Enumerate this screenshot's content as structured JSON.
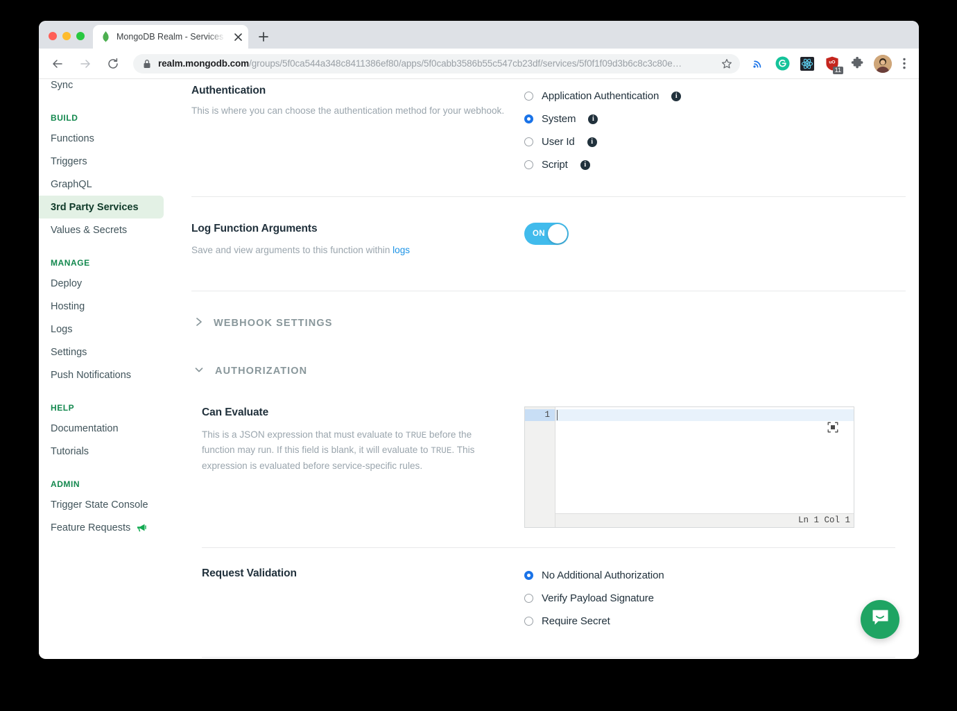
{
  "browser": {
    "tab": {
      "title": "MongoDB Realm - Services - k",
      "favicon": "mongodb-leaf-icon",
      "close_icon": "close-icon",
      "new_tab_icon": "plus-icon"
    },
    "toolbar": {
      "back_icon": "back-arrow-icon",
      "forward_icon": "forward-arrow-icon",
      "reload_icon": "reload-icon",
      "lock_icon": "lock-icon",
      "url_host": "realm.mongodb.com",
      "url_path": "/groups/5f0ca544a348c8411386ef80/apps/5f0cabb3586b55c547cb23df/services/5f0f1f09d3b6c8c3c80e…",
      "star_icon": "star-icon",
      "extensions": [
        {
          "name": "cast-icon",
          "label": ""
        },
        {
          "name": "grammarly-icon",
          "label": "G"
        },
        {
          "name": "react-devtools-icon",
          "label": ""
        },
        {
          "name": "ublock-origin-icon",
          "label": "uO",
          "badge": "11"
        },
        {
          "name": "puzzle-extensions-icon",
          "label": ""
        }
      ],
      "avatar": "user-avatar",
      "menu_icon": "three-dot-menu-icon"
    }
  },
  "sidebar": {
    "items": [
      {
        "label": "Sync",
        "type": "link",
        "selected": false
      },
      {
        "label": "BUILD",
        "type": "section"
      },
      {
        "label": "Functions",
        "type": "link",
        "selected": false
      },
      {
        "label": "Triggers",
        "type": "link",
        "selected": false
      },
      {
        "label": "GraphQL",
        "type": "link",
        "selected": false
      },
      {
        "label": "3rd Party Services",
        "type": "link",
        "selected": true
      },
      {
        "label": "Values & Secrets",
        "type": "link",
        "selected": false
      },
      {
        "label": "MANAGE",
        "type": "section"
      },
      {
        "label": "Deploy",
        "type": "link",
        "selected": false
      },
      {
        "label": "Hosting",
        "type": "link",
        "selected": false
      },
      {
        "label": "Logs",
        "type": "link",
        "selected": false
      },
      {
        "label": "Settings",
        "type": "link",
        "selected": false
      },
      {
        "label": "Push Notifications",
        "type": "link",
        "selected": false
      },
      {
        "label": "HELP",
        "type": "section"
      },
      {
        "label": "Documentation",
        "type": "link",
        "selected": false
      },
      {
        "label": "Tutorials",
        "type": "link",
        "selected": false
      },
      {
        "label": "ADMIN",
        "type": "section"
      },
      {
        "label": "Trigger State Console",
        "type": "link",
        "selected": false
      },
      {
        "label": "Feature Requests",
        "type": "link",
        "selected": false,
        "icon": "megaphone-icon"
      }
    ],
    "selected_bg": "#e3f1e5",
    "section_color": "#13884e"
  },
  "main": {
    "authentication": {
      "title": "Authentication",
      "description": "This is where you can choose the authentication method for your webhook.",
      "options": [
        {
          "label": "Application Authentication",
          "checked": false,
          "info": true
        },
        {
          "label": "System",
          "checked": true,
          "info": true
        },
        {
          "label": "User Id",
          "checked": false,
          "info": true
        },
        {
          "label": "Script",
          "checked": false,
          "info": true
        }
      ]
    },
    "log_function_arguments": {
      "title": "Log Function Arguments",
      "description_pre": "Save and view arguments to this function within ",
      "description_link": "logs",
      "toggle_state": "ON",
      "toggle_on": true,
      "toggle_color": "#41bbec"
    },
    "webhook_settings": {
      "caption": "WEBHOOK SETTINGS",
      "expanded": false,
      "chevron": "chevron-right-icon"
    },
    "authorization": {
      "caption": "AUTHORIZATION",
      "expanded": true,
      "chevron": "chevron-down-icon"
    },
    "can_evaluate": {
      "title": "Can Evaluate",
      "desc_1": "This is a JSON expression that must evaluate to ",
      "code_1": "TRUE",
      "desc_2": " before the function may run. If this field is blank, it will evaluate to ",
      "code_2": "TRUE",
      "desc_3": ". This expression is evaluated before service-specific rules.",
      "editor": {
        "line_number": "1",
        "content": "",
        "status": "Ln 1 Col 1",
        "expand_icon": "fullscreen-expand-icon"
      }
    },
    "request_validation": {
      "title": "Request Validation",
      "options": [
        {
          "label": "No Additional Authorization",
          "checked": true
        },
        {
          "label": "Verify Payload Signature",
          "checked": false
        },
        {
          "label": "Require Secret",
          "checked": false
        }
      ]
    },
    "intercom": {
      "icon": "intercom-chat-icon",
      "color": "#1fa463"
    }
  }
}
